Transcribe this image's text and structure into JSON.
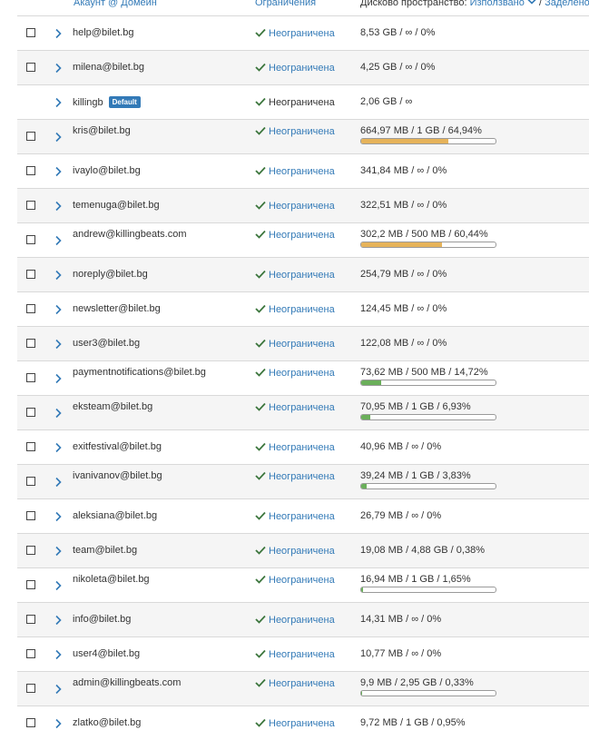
{
  "header": {
    "account_col": "Акаунт @ Домейн",
    "limits_col": "Ограничения",
    "disk_col": "Дисково пространство:",
    "sort_used": "Използвано",
    "sep": " / ",
    "sort_allocated": "Заделено",
    "sep2": " / "
  },
  "colors": {
    "accent": "#337ab7",
    "check": "#3c763d",
    "bar_warning": "#e6b35a",
    "bar_ok": "#6aaf5a"
  },
  "rows": [
    {
      "account": "help@bilet.bg",
      "limit": "Неограничена",
      "disk": "8,53 GB / ∞ / 0%",
      "checkbox": true
    },
    {
      "account": "milena@bilet.bg",
      "limit": "Неограничена",
      "disk": "4,25 GB / ∞ / 0%",
      "checkbox": true
    },
    {
      "account": "killingb",
      "badge": "Default",
      "limit": "Неограничена",
      "disk": "2,06 GB / ∞",
      "checkbox": false
    },
    {
      "account": "kris@bilet.bg",
      "limit": "Неограничена",
      "disk": "664,97 MB / 1 GB / 64,94%",
      "checkbox": true,
      "percent": 64.94,
      "bar_color": "#e6b35a"
    },
    {
      "account": "ivaylo@bilet.bg",
      "limit": "Неограничена",
      "disk": "341,84 MB / ∞ / 0%",
      "checkbox": true
    },
    {
      "account": "temenuga@bilet.bg",
      "limit": "Неограничена",
      "disk": "322,51 MB / ∞ / 0%",
      "checkbox": true
    },
    {
      "account": "andrew@killingbeats.com",
      "limit": "Неограничена",
      "disk": "302,2 MB / 500 MB / 60,44%",
      "checkbox": true,
      "percent": 60.44,
      "bar_color": "#e6b35a"
    },
    {
      "account": "noreply@bilet.bg",
      "limit": "Неограничена",
      "disk": "254,79 MB / ∞ / 0%",
      "checkbox": true
    },
    {
      "account": "newsletter@bilet.bg",
      "limit": "Неограничена",
      "disk": "124,45 MB / ∞ / 0%",
      "checkbox": true
    },
    {
      "account": "user3@bilet.bg",
      "limit": "Неограничена",
      "disk": "122,08 MB / ∞ / 0%",
      "checkbox": true
    },
    {
      "account": "paymentnotifications@bilet.bg",
      "limit": "Неограничена",
      "disk": "73,62 MB / 500 MB / 14,72%",
      "checkbox": true,
      "percent": 14.72,
      "bar_color": "#6aaf5a"
    },
    {
      "account": "eksteam@bilet.bg",
      "limit": "Неограничена",
      "disk": "70,95 MB / 1 GB / 6,93%",
      "checkbox": true,
      "percent": 6.93,
      "bar_color": "#6aaf5a"
    },
    {
      "account": "exitfestival@bilet.bg",
      "limit": "Неограничена",
      "disk": "40,96 MB / ∞ / 0%",
      "checkbox": true
    },
    {
      "account": "ivanivanov@bilet.bg",
      "limit": "Неограничена",
      "disk": "39,24 MB / 1 GB / 3,83%",
      "checkbox": true,
      "percent": 3.83,
      "bar_color": "#6aaf5a"
    },
    {
      "account": "aleksiana@bilet.bg",
      "limit": "Неограничена",
      "disk": "26,79 MB / ∞ / 0%",
      "checkbox": true
    },
    {
      "account": "team@bilet.bg",
      "limit": "Неограничена",
      "disk": "19,08 MB / 4,88 GB / 0,38%",
      "checkbox": true
    },
    {
      "account": "nikoleta@bilet.bg",
      "limit": "Неограничена",
      "disk": "16,94 MB / 1 GB / 1,65%",
      "checkbox": true,
      "percent": 1.65,
      "bar_color": "#6aaf5a"
    },
    {
      "account": "info@bilet.bg",
      "limit": "Неограничена",
      "disk": "14,31 MB / ∞ / 0%",
      "checkbox": true
    },
    {
      "account": "user4@bilet.bg",
      "limit": "Неограничена",
      "disk": "10,77 MB / ∞ / 0%",
      "checkbox": true
    },
    {
      "account": "admin@killingbeats.com",
      "limit": "Неограничена",
      "disk": "9,9 MB / 2,95 GB / 0,33%",
      "checkbox": true,
      "percent": 0.33,
      "bar_color": "#6aaf5a"
    },
    {
      "account": "zlatko@bilet.bg",
      "limit": "Неограничена",
      "disk": "9,72 MB / 1 GB / 0,95%",
      "checkbox": true
    }
  ]
}
